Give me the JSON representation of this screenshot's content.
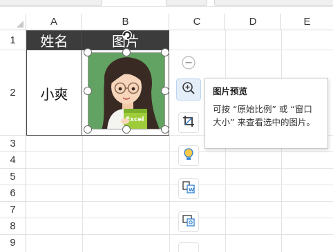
{
  "window": {
    "top_tabs": [
      "",
      ""
    ]
  },
  "sheet": {
    "columns": [
      "A",
      "B",
      "C",
      "D",
      "E"
    ],
    "rows": [
      "1",
      "2",
      "3",
      "4",
      "5",
      "6",
      "7",
      "8",
      "9"
    ],
    "cells": {
      "A1": "姓名",
      "B1": "图片",
      "A2": "小爽"
    },
    "header_fill": "#3c3c3c",
    "header_text_color": "#ffffff"
  },
  "picture": {
    "alt": "cartoon girl holding Excel book",
    "book_label": "Excel",
    "background_color": "#5f9e5f"
  },
  "float_toolbar": {
    "items": [
      {
        "icon": "collapse-icon"
      },
      {
        "icon": "zoom-in-icon"
      },
      {
        "icon": "crop-icon"
      },
      {
        "icon": "bulb-icon"
      },
      {
        "icon": "convert-image-icon"
      },
      {
        "icon": "image-link-icon"
      }
    ]
  },
  "tooltip": {
    "title": "图片预览",
    "body": "可按 “原始比例” 或 “窗口大小” 来查看选中的图片。"
  }
}
